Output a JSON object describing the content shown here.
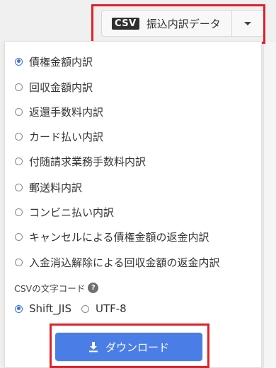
{
  "toolbar": {
    "csv_badge": "CSV",
    "button_label": "振込内訳データ"
  },
  "options": [
    {
      "label": "債権金額内訳",
      "checked": true
    },
    {
      "label": "回収金額内訳",
      "checked": false
    },
    {
      "label": "返還手数料内訳",
      "checked": false
    },
    {
      "label": "カード払い内訳",
      "checked": false
    },
    {
      "label": "付随請求業務手数料内訳",
      "checked": false
    },
    {
      "label": "郵送料内訳",
      "checked": false
    },
    {
      "label": "コンビニ払い内訳",
      "checked": false
    },
    {
      "label": "キャンセルによる債権金額の返金内訳",
      "checked": false
    },
    {
      "label": "入金消込解除による回収金額の返金内訳",
      "checked": false
    }
  ],
  "encoding": {
    "label": "CSVの文字コード",
    "help_glyph": "?",
    "options": [
      {
        "label": "Shift_JIS",
        "checked": true
      },
      {
        "label": "UTF-8",
        "checked": false
      }
    ]
  },
  "download": {
    "label": "ダウンロード"
  },
  "colors": {
    "accent": "#4a7ee6",
    "highlight": "#e0202a"
  }
}
